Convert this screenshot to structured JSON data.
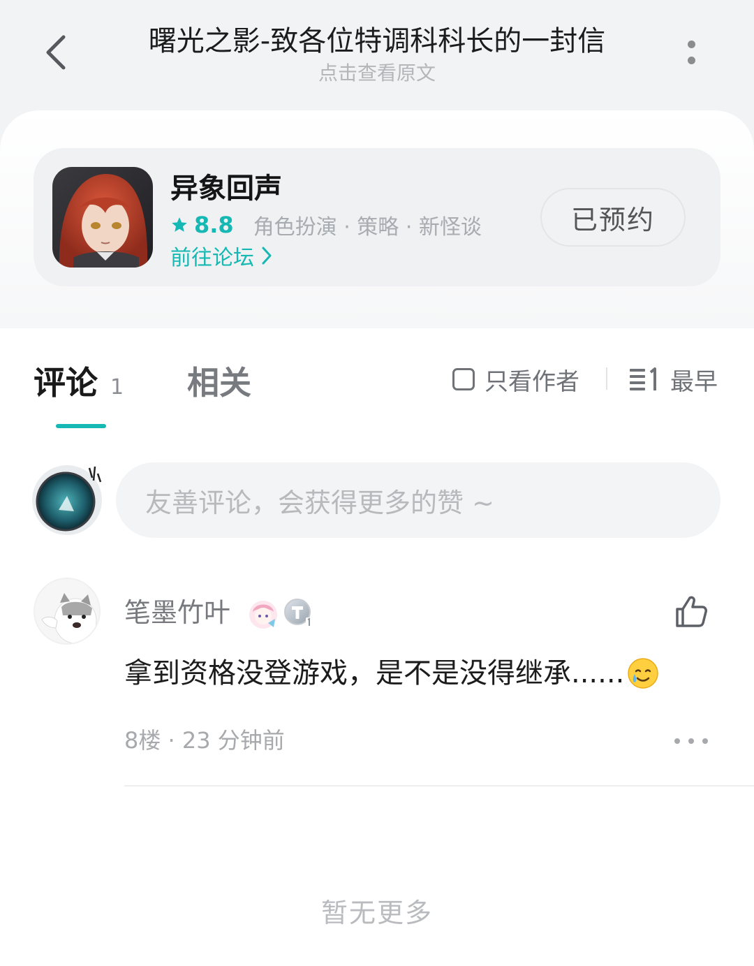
{
  "header": {
    "title": "曙光之影-致各位特调科科长的一封信",
    "subtitle": "点击查看原文"
  },
  "game_card": {
    "name": "异象回声",
    "rating": "8.8",
    "tags": "角色扮演 · 策略 · 新怪谈",
    "forum_link": "前往论坛",
    "reserve_label": "已预约"
  },
  "tabs": {
    "comments_label": "评论",
    "comments_count": "1",
    "related_label": "相关",
    "author_only_label": "只看作者",
    "sort_label": "最早"
  },
  "comment_input": {
    "placeholder": "友善评论，会获得更多的赞 ~"
  },
  "comments": [
    {
      "username": "笔墨竹叶",
      "text": "拿到资格没登游戏，是不是没得继承......",
      "emoji": "tearful-smile-emoji",
      "meta": "8楼 · 23 分钟前"
    }
  ],
  "footer": {
    "end_text": "暂无更多"
  },
  "colors": {
    "accent": "#15b8b3",
    "background_top": "#f2f3f5",
    "card_bg": "#eff1f3"
  }
}
